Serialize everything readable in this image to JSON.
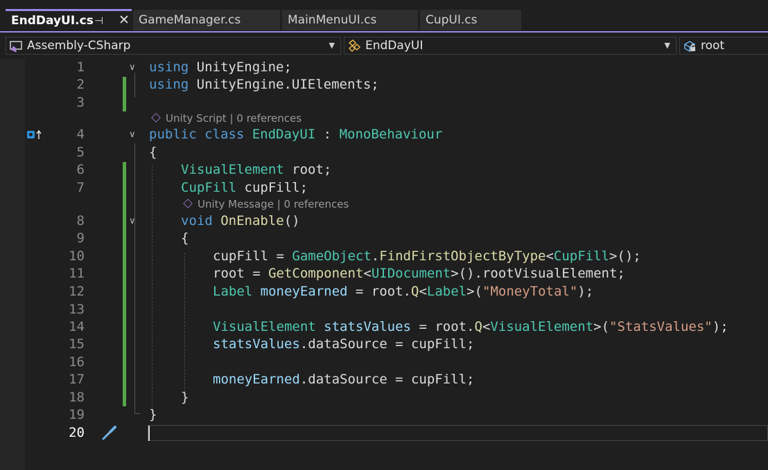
{
  "tabs": [
    {
      "label": "EndDayUI.cs",
      "active": true
    },
    {
      "label": "GameManager.cs"
    },
    {
      "label": "MainMenuUI.cs"
    },
    {
      "label": "CupUI.cs"
    }
  ],
  "tab_pin_glyph": "⊣",
  "tab_close_glyph": "✕",
  "navbar": {
    "project": "Assembly-CSharp",
    "type": "EndDayUI",
    "member": "root"
  },
  "codelens": [
    {
      "text": "Unity Script | 0 references"
    },
    {
      "text": "Unity Message | 0 references"
    }
  ],
  "line_numbers": [
    "1",
    "2",
    "3",
    "4",
    "5",
    "6",
    "7",
    "8",
    "9",
    "10",
    "11",
    "12",
    "13",
    "14",
    "15",
    "16",
    "17",
    "18",
    "19",
    "20"
  ],
  "code": {
    "l1": {
      "kw": "using",
      "rest": " UnityEngine;"
    },
    "l2": {
      "kw": "using",
      "rest": " UnityEngine.UIElements;"
    },
    "l4": {
      "kw1": "public",
      "kw2": " class",
      "name": " EndDayUI",
      "sep": " : ",
      "base": "MonoBehaviour"
    },
    "l5": {
      "text": "{"
    },
    "l6": {
      "type": "VisualElement",
      "rest": " root;"
    },
    "l7": {
      "type": "CupFill",
      "rest": " cupFill;"
    },
    "l8": {
      "kw": "void",
      "fn": " OnEnable",
      "rest": "()"
    },
    "l9": {
      "text": "{"
    },
    "l10": {
      "a": "cupFill = ",
      "t1": "GameObject",
      "b": ".",
      "fn": "FindFirstObjectByType",
      "c": "<",
      "t2": "CupFill",
      "d": ">();"
    },
    "l11": {
      "a": "root = ",
      "fn": "GetComponent",
      "b": "<",
      "t1": "UIDocument",
      "c": ">().rootVisualElement;"
    },
    "l12": {
      "t1": "Label",
      "var": " moneyEarned",
      "a": " = root.",
      "fn": "Q",
      "b": "<",
      "t2": "Label",
      "c": ">(",
      "str": "\"MoneyTotal\"",
      "d": ");"
    },
    "l14": {
      "t1": "VisualElement",
      "var": " statsValues",
      "a": " = root.",
      "fn": "Q",
      "b": "<",
      "t2": "VisualElement",
      "c": ">(",
      "str": "\"StatsValues\"",
      "d": ");"
    },
    "l15": {
      "var": "statsValues",
      "a": ".dataSource = cupFill;"
    },
    "l17": {
      "var": "moneyEarned",
      "a": ".dataSource = cupFill;"
    },
    "l18": {
      "text": "}"
    },
    "l19": {
      "text": "}"
    }
  },
  "colors": {
    "accent": "#9b87e8",
    "keyword": "#569cd6",
    "type": "#4ec9b0",
    "method": "#dcdcaa",
    "string": "#d69d85",
    "variable": "#9cdcfe",
    "changed_bar": "#57a64a"
  }
}
